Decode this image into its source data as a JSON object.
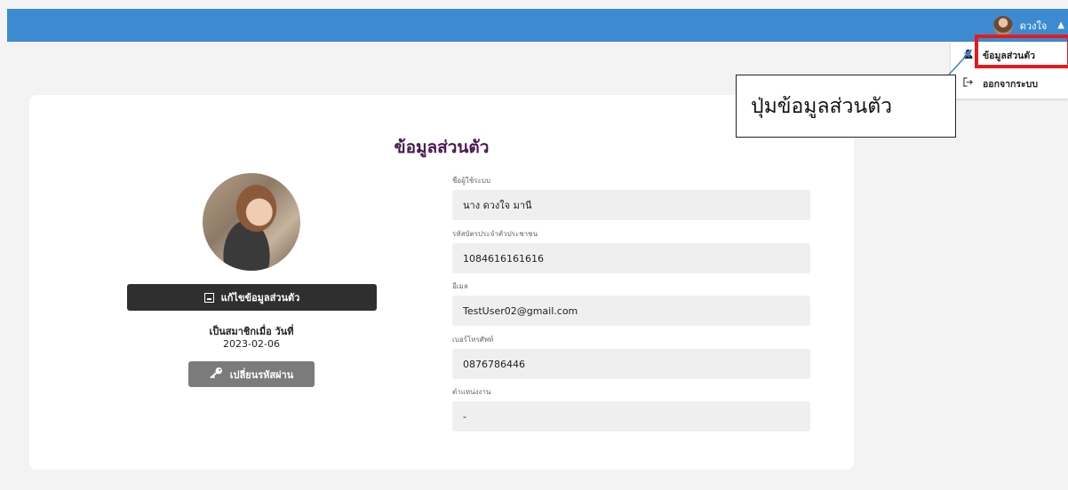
{
  "header": {
    "user_name": "ดวงใจ",
    "caret": "▲"
  },
  "dropdown": {
    "profile_label": "ข้อมูลส่วนตัว",
    "logout_label": "ออกจากระบบ"
  },
  "callout": {
    "text": "ปุ่มข้อมูลส่วนตัว"
  },
  "profile": {
    "title": "ข้อมูลส่วนตัว",
    "edit_button": "แก้ไขข้อมูลส่วนตัว",
    "member_since_label": "เป็นสมาชิกเมื่อ วันที่",
    "member_since_date": "2023-02-06",
    "change_password_button": "เปลี่ยนรหัสผ่าน"
  },
  "fields": [
    {
      "label": "ชื่อผู้ใช้ระบบ",
      "value": "นาง ดวงใจ มานี"
    },
    {
      "label": "รหัสบัตรประจำตัวประชาชน",
      "value": "1084616161616"
    },
    {
      "label": "อีเมล",
      "value": "TestUser02@gmail.com"
    },
    {
      "label": "เบอร์โทรศัพท์",
      "value": "0876786446"
    },
    {
      "label": "ตำแหน่งงาน",
      "value": "-"
    }
  ],
  "colors": {
    "header": "#3d8ad0",
    "title": "#4a1a52",
    "highlight": "#e31b1b",
    "arrow": "#3d7fc4"
  },
  "icons": {
    "avatar_small": "avatar-icon",
    "profile": "user-icon",
    "logout": "logout-icon",
    "edit": "id-card-icon",
    "password": "key-icon"
  }
}
